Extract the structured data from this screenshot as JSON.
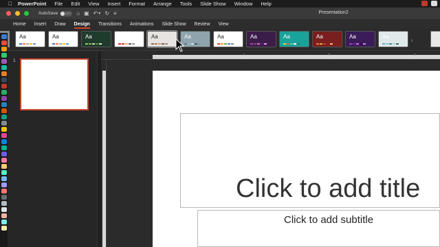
{
  "menubar": {
    "app": "PowerPoint",
    "items": [
      "File",
      "Edit",
      "View",
      "Insert",
      "Format",
      "Arrange",
      "Tools",
      "Slide Show",
      "Window",
      "Help"
    ]
  },
  "titlebar": {
    "autosave_label": "AutoSave",
    "autosave_state": "OFF",
    "doc_title": "Presentation2"
  },
  "tabs": [
    "Home",
    "Insert",
    "Draw",
    "Design",
    "Transitions",
    "Animations",
    "Slide Show",
    "Review",
    "View"
  ],
  "active_tab": "Design",
  "themes": [
    {
      "aa": "Aa",
      "bg": "#ffffff",
      "fg": "#222",
      "bars": [
        "#4472c4",
        "#ed7d31",
        "#a5a5a5",
        "#ffc000",
        "#5b9bd5"
      ]
    },
    {
      "aa": "Aa",
      "bg": "#ffffff",
      "fg": "#222",
      "bars": [
        "#4472c4",
        "#ed7d31",
        "#a5a5a5",
        "#ffc000",
        "#5b9bd5"
      ]
    },
    {
      "aa": "Aa",
      "bg": "#1f3b2c",
      "fg": "#fff",
      "bars": [
        "#a0c46a",
        "#7eb05a",
        "#c7d9a8",
        "#5e8a3c",
        "#e0e8c8"
      ]
    },
    {
      "aa": "Aa",
      "bg": "#ffffff",
      "fg": "#fff",
      "bars": [
        "#e0201f",
        "#c0392b",
        "#f2a35a",
        "#555",
        "#999"
      ]
    },
    {
      "aa": "Aa",
      "bg": "#e6e3e0",
      "fg": "#222",
      "bars": [
        "#8a6a5a",
        "#b47850",
        "#c9a27a",
        "#6a5a4a",
        "#998877"
      ]
    },
    {
      "aa": "Aa",
      "bg": "#8fa4ad",
      "fg": "#fff",
      "bars": [
        "#5a7a8a",
        "#a0b8c0",
        "#d0dde0",
        "#3a5a6a",
        "#789aa8"
      ]
    },
    {
      "aa": "Aa",
      "bg": "#ffffff",
      "fg": "#222",
      "bars": [
        "#d04030",
        "#e8a030",
        "#70a040",
        "#4080c0",
        "#888"
      ]
    },
    {
      "aa": "Aa",
      "bg": "#3b1d4a",
      "fg": "#fff",
      "bars": [
        "#c04890",
        "#8040a0",
        "#e070b0",
        "#5020a0",
        "#f0a0d0"
      ]
    },
    {
      "aa": "Aa",
      "bg": "#1aa39a",
      "fg": "#fff",
      "bars": [
        "#f0d040",
        "#e07030",
        "#60c0b0",
        "#ffffff",
        "#2a7a70"
      ]
    },
    {
      "aa": "Aa",
      "bg": "#7a1e1e",
      "fg": "#fff",
      "bars": [
        "#f08030",
        "#e0b040",
        "#c04030",
        "#902020",
        "#f0c070"
      ]
    },
    {
      "aa": "Aa",
      "bg": "#3b1c5a",
      "fg": "#fff",
      "bars": [
        "#a040c0",
        "#6030a0",
        "#e070e0",
        "#2a1050",
        "#c090e0"
      ]
    },
    {
      "aa": "Aa",
      "bg": "#dfe9ea",
      "fg": "#fff",
      "bars": [
        "#6aa8b0",
        "#88c0c8",
        "#4a8a90",
        "#a8d0d4",
        "#2a6a70"
      ]
    }
  ],
  "slides": [
    {
      "number": "1"
    }
  ],
  "hruler_ticks": [
    "1",
    "0",
    "1"
  ],
  "slide": {
    "title_placeholder": "Click to add title",
    "subtitle_placeholder": "Click to add subtitle"
  },
  "colors": {
    "accent": "#d24726",
    "thumb_border": "#c0452a"
  }
}
